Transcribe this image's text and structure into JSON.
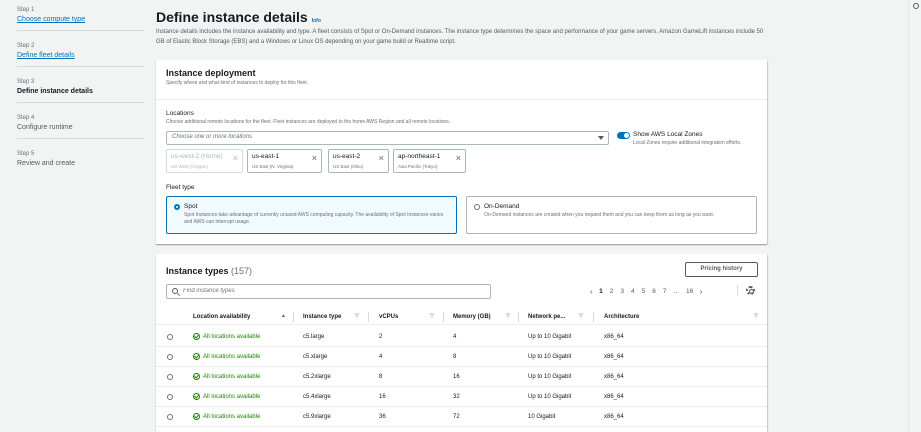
{
  "steps": [
    {
      "num": "Step 1",
      "label": "Choose compute type",
      "state": "link"
    },
    {
      "num": "Step 2",
      "label": "Define fleet details",
      "state": "link"
    },
    {
      "num": "Step 3",
      "label": "Define instance details",
      "state": "current"
    },
    {
      "num": "Step 4",
      "label": "Configure runtime",
      "state": "muted"
    },
    {
      "num": "Step 5",
      "label": "Review and create",
      "state": "muted"
    }
  ],
  "page": {
    "title": "Define instance details",
    "info": "Info",
    "description": "Instance details includes the instance availability and type. A fleet consists of Spot or On-Demand instances. The instance type determines the space and performance of your game servers. Amazon GameLift instances include 50 GB of Elastic Block Storage (EBS) and a Windows or Linux OS depending on your game build or Realtime script."
  },
  "deployment": {
    "title": "Instance deployment",
    "subtitle": "Specify where and what kind of instances to deploy for this fleet.",
    "locations_label": "Locations",
    "locations_desc": "Choose additional remote locations for the fleet. Fleet instances are deployed to the home AWS Region and all remote locations.",
    "locations_placeholder": "Choose one or more locations",
    "local_zones_label": "Show AWS Local Zones",
    "local_zones_desc": "Local Zones require additional integration efforts.",
    "local_zones_on": true,
    "tokens": [
      {
        "name": "us-west-2 (Home)",
        "sub": "US West (Oregon)",
        "disabled": true
      },
      {
        "name": "us-east-1",
        "sub": "US East (N. Virginia)",
        "disabled": false
      },
      {
        "name": "us-east-2",
        "sub": "US East (Ohio)",
        "disabled": false
      },
      {
        "name": "ap-northeast-1",
        "sub": "Asia Pacific (Tokyo)",
        "disabled": false
      }
    ],
    "fleet_type_label": "Fleet type",
    "spot": {
      "title": "Spot",
      "desc": "Spot Instances take advantage of currently unused AWS computing capacity. The availability of Spot Instances varies and AWS can interrupt usage.",
      "selected": true
    },
    "ondemand": {
      "title": "On-Demand",
      "desc": "On-Demand instances are created when you request them and you can keep them as long as you want.",
      "selected": false
    }
  },
  "instance_types": {
    "title": "Instance types",
    "count": "(157)",
    "pricing_button": "Pricing history",
    "search_placeholder": "Find instance types",
    "pages": [
      "1",
      "2",
      "3",
      "4",
      "5",
      "6",
      "7",
      "...",
      "16"
    ],
    "current_page": "1",
    "columns": [
      "Location availability",
      "Instance type",
      "vCPUs",
      "Memory (GB)",
      "Network pe...",
      "Architecture"
    ],
    "rows": [
      {
        "availability": "All locations available",
        "type": "c5.large",
        "vcpus": "2",
        "memory": "4",
        "network": "Up to 10 Gigabit",
        "arch": "x86_64"
      },
      {
        "availability": "All locations available",
        "type": "c5.xlarge",
        "vcpus": "4",
        "memory": "8",
        "network": "Up to 10 Gigabit",
        "arch": "x86_64"
      },
      {
        "availability": "All locations available",
        "type": "c5.2xlarge",
        "vcpus": "8",
        "memory": "16",
        "network": "Up to 10 Gigabit",
        "arch": "x86_64"
      },
      {
        "availability": "All locations available",
        "type": "c5.4xlarge",
        "vcpus": "16",
        "memory": "32",
        "network": "Up to 10 Gigabit",
        "arch": "x86_64"
      },
      {
        "availability": "All locations available",
        "type": "c5.9xlarge",
        "vcpus": "36",
        "memory": "72",
        "network": "10 Gigabit",
        "arch": "x86_64"
      }
    ]
  },
  "colors": {
    "link": "#0073bb",
    "success": "#1d8102",
    "text": "#16191f",
    "muted": "#687078"
  }
}
